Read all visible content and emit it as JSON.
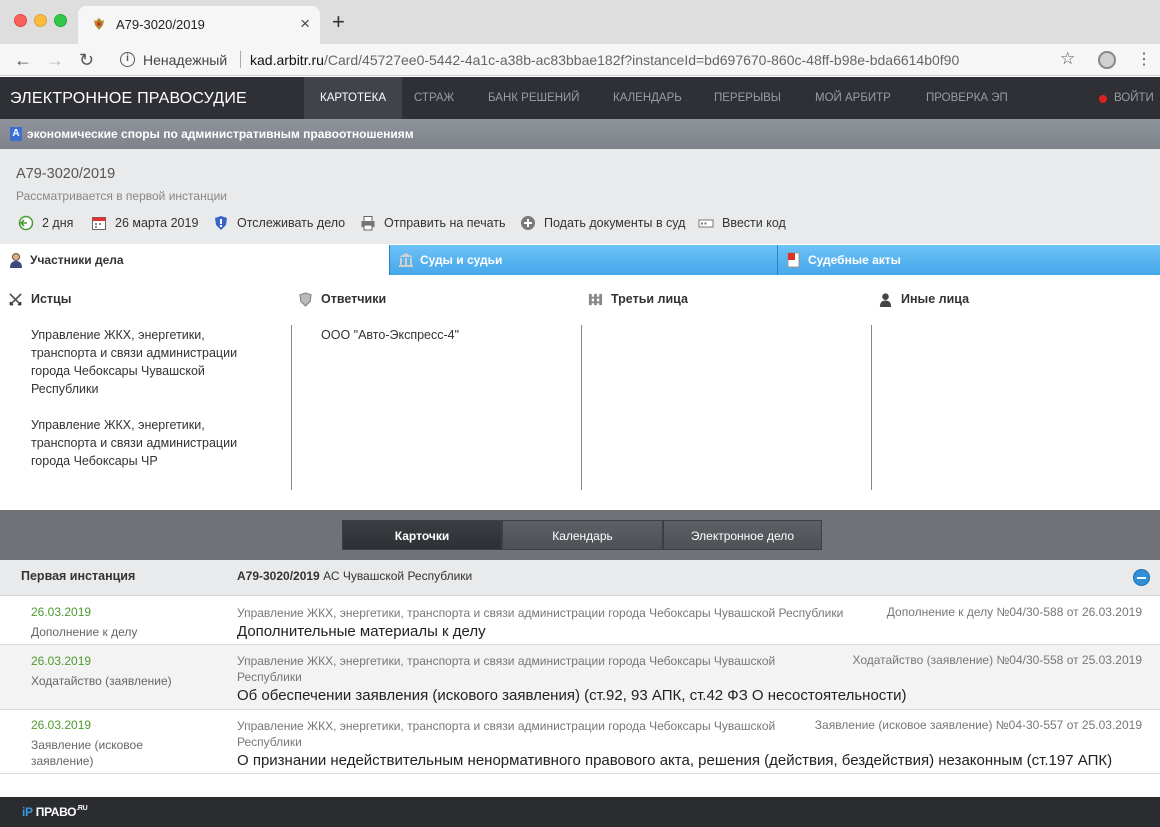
{
  "browser": {
    "tab_title": "А79-3020/2019",
    "tab_close": "×",
    "new_tab": "+",
    "insecure_label": "Ненадежный",
    "url_host": "kad.arbitr.ru",
    "url_path": "/Card/45727ee0-5442-4a1c-a38b-ac83bbae182f?instanceId=bd697670-860c-48ff-b98e-bda6614b0f90"
  },
  "site": {
    "logo": "ЭЛЕКТРОННОЕ ПРАВОСУДИЕ",
    "nav": [
      "КАРТОТЕКА",
      "СТРАЖ",
      "БАНК РЕШЕНИЙ",
      "КАЛЕНДАРЬ",
      "ПЕРЕРЫВЫ",
      "МОЙ АРБИТР",
      "ПРОВЕРКА ЭП"
    ],
    "login": "ВОЙТИ",
    "category_badge": "А",
    "category": "экономические споры по административным правоотношениям"
  },
  "case": {
    "number": "А79-3020/2019",
    "status": "Рассматривается в первой инстанции",
    "actions": {
      "days": "2 дня",
      "date": "26 марта 2019",
      "track": "Отслеживать дело",
      "print": "Отправить на печать",
      "submit": "Подать документы в суд",
      "code": "Ввести код"
    }
  },
  "tabs": {
    "participants": "Участники дела",
    "courts": "Суды и судьи",
    "acts": "Судебные акты"
  },
  "participants": {
    "plaintiffs_label": "Истцы",
    "defendants_label": "Ответчики",
    "third_label": "Третьи лица",
    "other_label": "Иные лица",
    "plaintiffs": [
      "Управление ЖКХ, энергетики, транспорта и связи администрации города Чебоксары Чувашской Республики",
      "Управление ЖКХ, энергетики, транспорта и связи администрации города Чебоксары ЧР"
    ],
    "defendants": [
      "ООО \"Авто-Экспресс-4\""
    ]
  },
  "views": {
    "cards": "Карточки",
    "calendar": "Календарь",
    "edoc": "Электронное дело"
  },
  "instance": {
    "title": "Первая инстанция",
    "case_number": "А79-3020/2019",
    "court": "АС Чувашской Республики"
  },
  "documents": [
    {
      "date": "26.03.2019",
      "type": "Дополнение к делу",
      "court": "Управление ЖКХ, энергетики, транспорта и связи администрации города Чебоксары Чувашской Республики",
      "ref": "Дополнение к делу №04/30-588 от 26.03.2019",
      "title": "Дополнительные материалы к делу"
    },
    {
      "date": "26.03.2019",
      "type": "Ходатайство (заявление)",
      "court": "Управление ЖКХ, энергетики, транспорта и связи администрации города Чебоксары Чувашской Республики",
      "ref": "Ходатайство (заявление) №04/30-558 от 25.03.2019",
      "title": "Об обеспечении заявления (искового заявления) (ст.92, 93 АПК, ст.42 ФЗ О несостоятельности)"
    },
    {
      "date": "26.03.2019",
      "type": "Заявление (исковое заявление)",
      "court": "Управление ЖКХ, энергетики, транспорта и связи администрации города Чебоксары Чувашской Республики",
      "ref": "Заявление (исковое заявление) №04-30-557 от 25.03.2019",
      "title": "О признании недействительным ненормативного правового акта, решения (действия, бездействия) незаконным (ст.197 АПК)"
    }
  ],
  "footer": {
    "logo_mark": "iP",
    "logo": "ПРАВО",
    "logo_ru": ".RU"
  },
  "colors": {
    "accent_blue": "#45a7ea",
    "date_green": "#4e9a2e",
    "header_dark": "#2e3035"
  }
}
